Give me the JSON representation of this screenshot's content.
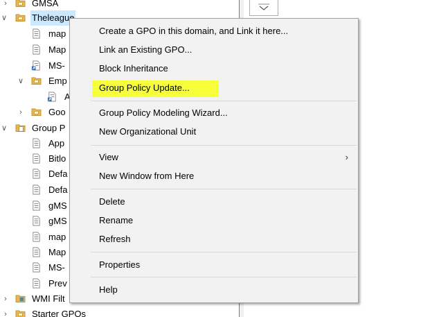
{
  "tree": {
    "items": [
      {
        "label": "GMSA"
      },
      {
        "label": "Theleague"
      },
      {
        "label": "map"
      },
      {
        "label": "Map"
      },
      {
        "label": "MS-"
      },
      {
        "label": "Emp"
      },
      {
        "label": "A"
      },
      {
        "label": "Goo"
      },
      {
        "label": "Group P"
      },
      {
        "label": "App"
      },
      {
        "label": "Bitlo"
      },
      {
        "label": "Defa"
      },
      {
        "label": "Defa"
      },
      {
        "label": "gMS"
      },
      {
        "label": "gMS"
      },
      {
        "label": "map"
      },
      {
        "label": "Map"
      },
      {
        "label": "MS-"
      },
      {
        "label": "Prev"
      },
      {
        "label": "WMI Filt"
      },
      {
        "label": "Starter GPOs"
      }
    ]
  },
  "context_menu": {
    "items": [
      {
        "label": "Create a GPO in this domain, and Link it here..."
      },
      {
        "label": "Link an Existing GPO..."
      },
      {
        "label": "Block Inheritance"
      },
      {
        "label": "Group Policy Update..."
      },
      {
        "label": "Group Policy Modeling Wizard..."
      },
      {
        "label": "New Organizational Unit"
      },
      {
        "label": "View"
      },
      {
        "label": "New Window from Here"
      },
      {
        "label": "Delete"
      },
      {
        "label": "Rename"
      },
      {
        "label": "Refresh"
      },
      {
        "label": "Properties"
      },
      {
        "label": "Help"
      }
    ]
  },
  "colors": {
    "highlight": "#f7ff3a",
    "selection": "#cce8ff",
    "folder": "#e8b84a"
  }
}
